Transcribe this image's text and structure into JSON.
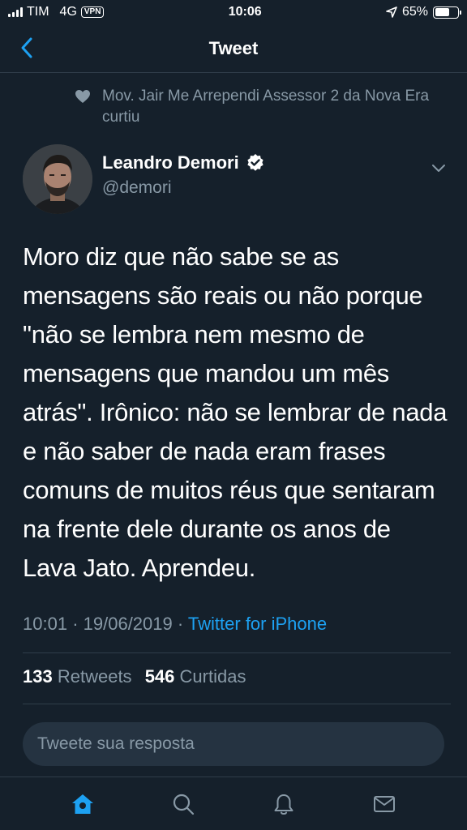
{
  "status_bar": {
    "carrier": "TIM",
    "network": "4G",
    "vpn": "VPN",
    "time": "10:06",
    "battery": "65%",
    "battery_level": 0.65
  },
  "nav": {
    "title": "Tweet"
  },
  "social_context": {
    "text": "Mov. Jair Me Arrependi Assessor 2 da Nova Era curtiu"
  },
  "author": {
    "name": "Leandro Demori",
    "handle": "@demori",
    "verified": true
  },
  "tweet": {
    "text": "Moro diz que não sabe se as mensagens são reais ou não porque \"não se lembra nem mesmo de mensagens que mandou um mês atrás\". Irônico: não se lembrar de nada e não saber de nada eram frases comuns de muitos réus que sentaram na frente dele durante os anos de Lava Jato. Aprendeu.",
    "time": "10:01",
    "date": "19/06/2019",
    "source": "Twitter for iPhone"
  },
  "stats": {
    "retweets_count": "133",
    "retweets_label": "Retweets",
    "likes_count": "546",
    "likes_label": "Curtidas"
  },
  "reply": {
    "placeholder": "Tweete sua resposta"
  },
  "tabs": [
    {
      "icon": "home-icon",
      "active": true
    },
    {
      "icon": "search-icon",
      "active": false
    },
    {
      "icon": "bell-icon",
      "active": false
    },
    {
      "icon": "mail-icon",
      "active": false
    }
  ],
  "colors": {
    "background": "#15202b",
    "accent": "#1da1f2",
    "secondary_text": "#8899a6",
    "divider": "#2f3d4a"
  }
}
